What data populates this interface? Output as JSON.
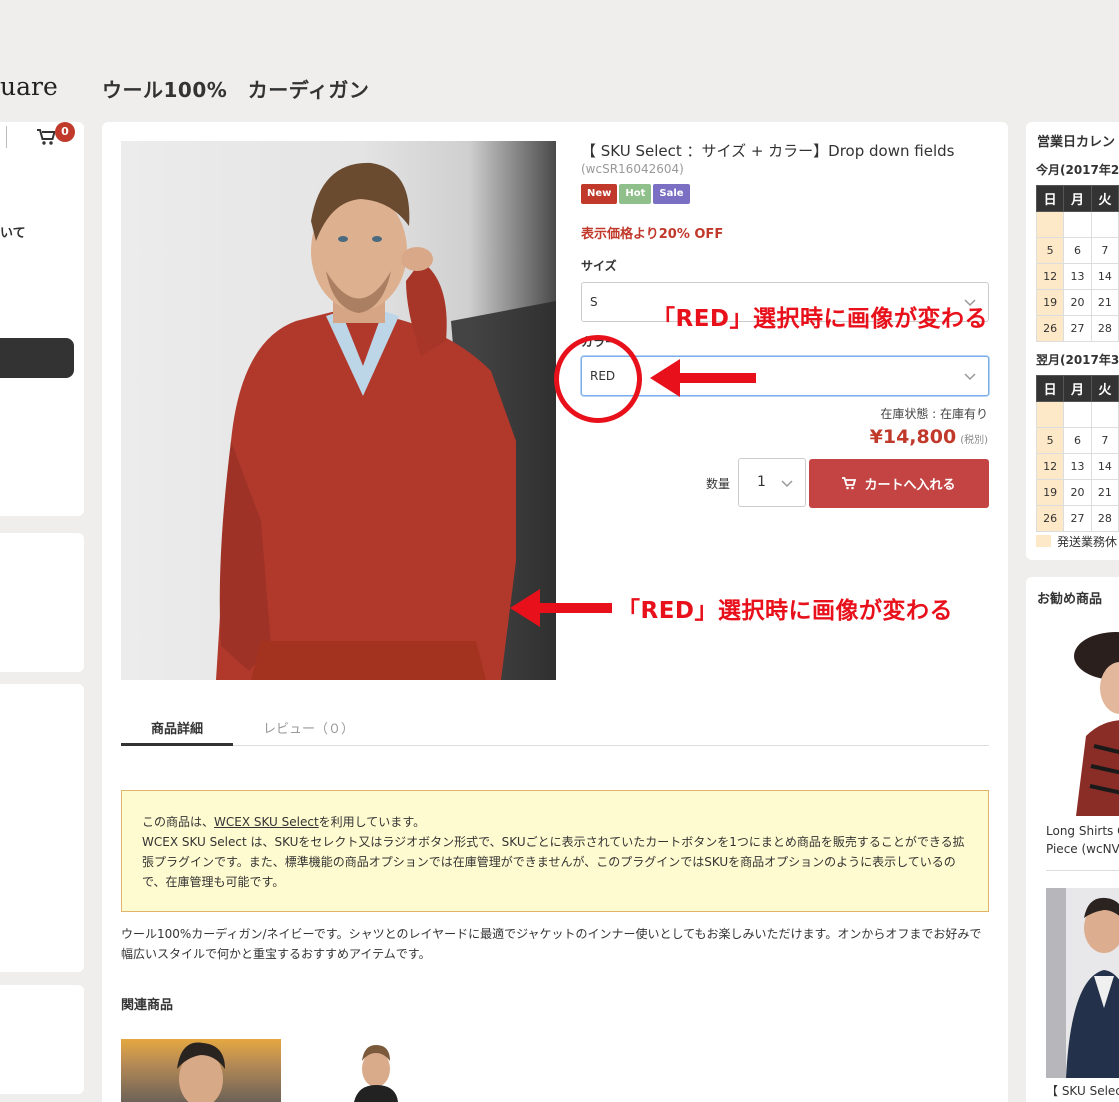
{
  "site": {
    "logo": "uare",
    "cart_count": "0",
    "nav_text": "いて"
  },
  "page_title": "ウール100%　カーディガン",
  "product": {
    "name": "【 SKU Select ：サイズ + カラー】Drop down fields",
    "code": "(wcSR16042604)",
    "badges": [
      {
        "label": "New",
        "color": "#c0392b"
      },
      {
        "label": "Hot",
        "color": "#8fbf8a"
      },
      {
        "label": "Sale",
        "color": "#7a6fc2"
      }
    ],
    "price_note": "表示価格より20% OFF",
    "size_label": "サイズ",
    "size_value": "S",
    "color_label": "カラー",
    "color_value": "RED",
    "stock": "在庫状態 : 在庫有り",
    "price": "¥14,800",
    "price_tax": "(税別)",
    "qty_label": "数量",
    "qty_value": "1",
    "cart_button": "カートへ入れる"
  },
  "annotations": {
    "text_1": "「RED」選択時に画像が変わる",
    "text_2": "「RED」選択時に画像が変わる",
    "color": "#e8111b"
  },
  "tabs": [
    {
      "label": "商品詳細",
      "active": true
    },
    {
      "label": "レビュー（０）",
      "active": false
    }
  ],
  "notice": {
    "prefix": "この商品は、",
    "link": "WCEX SKU Select",
    "suffix": "を利用しています。",
    "line2": "WCEX SKU Select は、SKUをセレクト又はラジオボタン形式で、SKUごとに表示されていたカートボタンを1つにまとめ商品を販売することができる拡張プラグインです。また、標準機能の商品オプションでは在庫管理ができませんが、このプラグインではSKUを商品オプションのように表示しているので、在庫管理も可能です。"
  },
  "description": "ウール100%カーディガン/ネイビーです。シャツとのレイヤードに最適でジャケットのインナー使いとしてもお楽しみいただけます。オンからオフまでお好みで幅広いスタイルで何かと重宝するおすすめアイテムです。",
  "related_title": "関連商品",
  "calendar": {
    "title": "営業日カレン",
    "month1": "今月(2017年2月",
    "month2": "翌月(2017年3月",
    "weekdays": [
      "日",
      "月",
      "火"
    ],
    "month1_rows": [
      [
        "",
        "",
        ""
      ],
      [
        "5",
        "6",
        "7"
      ],
      [
        "12",
        "13",
        "14"
      ],
      [
        "19",
        "20",
        "21"
      ],
      [
        "26",
        "27",
        "28"
      ]
    ],
    "month2_rows": [
      [
        "",
        "",
        ""
      ],
      [
        "5",
        "6",
        "7"
      ],
      [
        "12",
        "13",
        "14"
      ],
      [
        "19",
        "20",
        "21"
      ],
      [
        "26",
        "27",
        "28"
      ]
    ],
    "legend": "発送業務休"
  },
  "recommend": {
    "title": "お勧め商品",
    "item1_line1": "Long Shirts O",
    "item1_line2": "Piece (wcNV",
    "item2": "【 SKU Selec"
  }
}
